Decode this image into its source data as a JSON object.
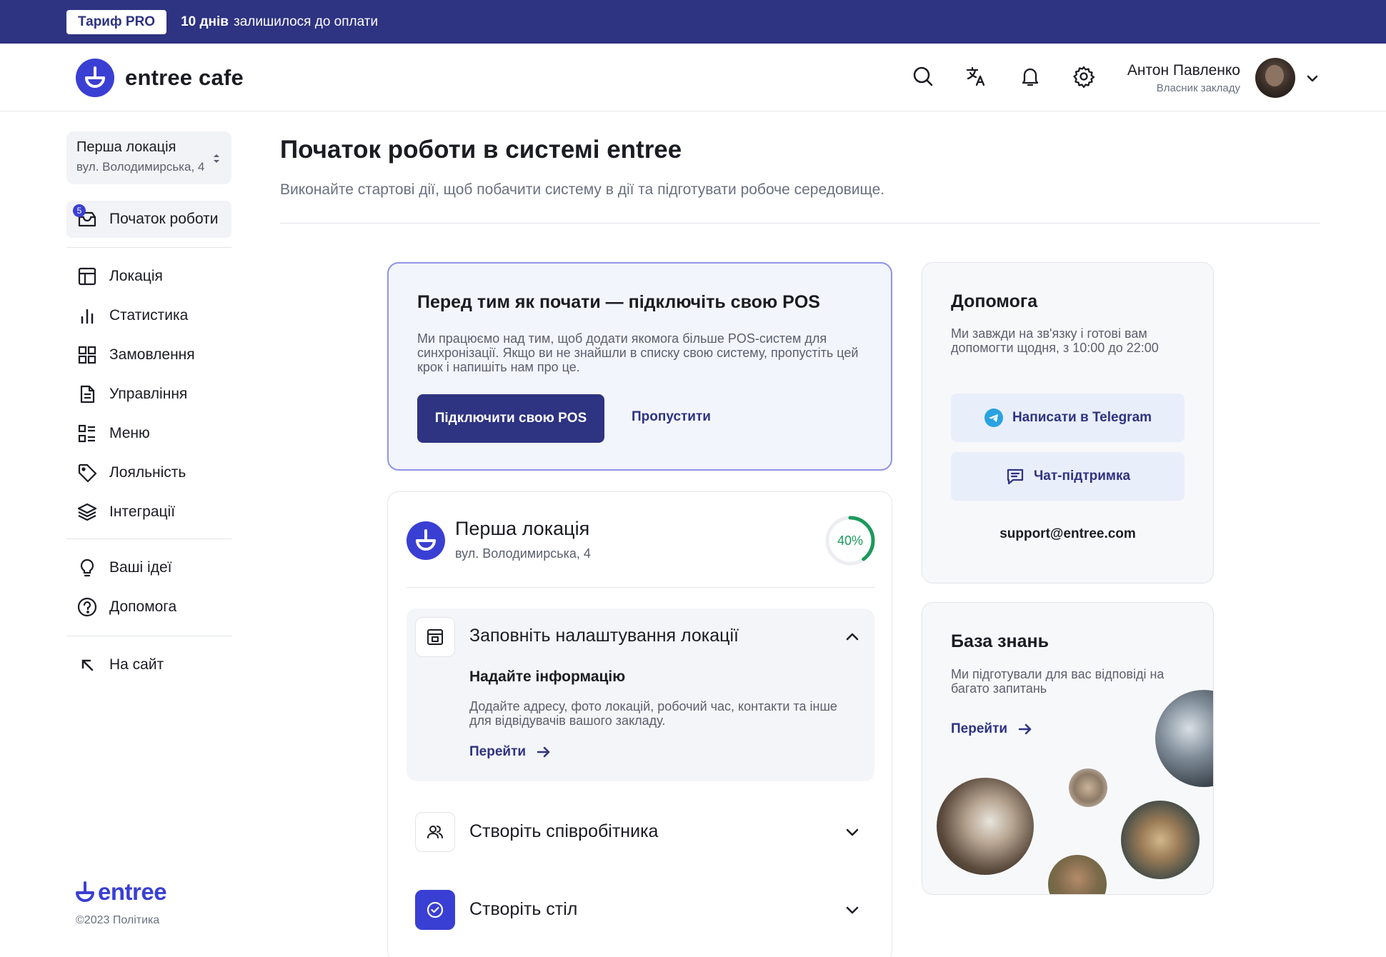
{
  "banner": {
    "plan": "Тариф PRO",
    "days": "10 днів",
    "rest": "залишилося до оплати"
  },
  "header": {
    "logo_text": "entree cafe",
    "user_name": "Антон Павленко",
    "user_role": "Власник закладу",
    "icons": [
      "search-icon",
      "translate-icon",
      "bell-icon",
      "gear-icon"
    ]
  },
  "sidebar": {
    "location": {
      "name": "Перша локація",
      "address": "вул. Володимирська, 4"
    },
    "start": {
      "label": "Початок роботи",
      "badge": "5"
    },
    "items": [
      {
        "label": "Локація",
        "icon": "layout-icon"
      },
      {
        "label": "Статистика",
        "icon": "bar-chart-icon"
      },
      {
        "label": "Замовлення",
        "icon": "grid-icon"
      },
      {
        "label": "Управління",
        "icon": "document-icon"
      },
      {
        "label": "Меню",
        "icon": "menu-list-icon"
      },
      {
        "label": "Лояльність",
        "icon": "tag-icon"
      },
      {
        "label": "Інтеграції",
        "icon": "layers-icon"
      }
    ],
    "secondary": [
      {
        "label": "Ваші ідеї",
        "icon": "lightbulb-icon"
      },
      {
        "label": "Допомога",
        "icon": "help-circle-icon"
      }
    ],
    "site": {
      "label": "На сайт",
      "icon": "arrow-up-left-icon"
    },
    "footer": {
      "logo": "entree",
      "copyright": "©2023",
      "policy": "Політика"
    }
  },
  "main": {
    "title": "Початок роботи в системі entree",
    "subtitle": "Виконайте стартові дії, щоб побачити систему в дії та підготувати робоче середовище."
  },
  "pos_card": {
    "title": "Перед тим як почати — підключіть свою POS",
    "text": "Ми працюємо над тим, щоб додати якомога більше POS-систем для синхронізації. Якщо ви не знайшли в списку свою систему, пропустіть цей крок і напишіть нам про це.",
    "primary": "Підключити свою POS",
    "skip": "Пропустити"
  },
  "location_card": {
    "name": "Перша локація",
    "address": "вул. Володимирська, 4",
    "progress_label": "40%",
    "progress": 0.4,
    "steps": [
      {
        "title": "Заповніть налаштування локації",
        "subtitle": "Надайте інформацію",
        "description": "Додайте адресу, фото локацій, робочий час, контакти та інше для відвідувачів вашого закладу.",
        "link": "Перейти",
        "expanded": true
      },
      {
        "title": "Створіть співробітника",
        "expanded": false
      },
      {
        "title": "Створіть стіл",
        "expanded": false,
        "done": true
      }
    ]
  },
  "help_card": {
    "title": "Допомога",
    "text": "Ми завжди на зв'язку і готові вам допомогти щодня, з 10:00 до 22:00",
    "telegram": "Написати в Telegram",
    "chat": "Чат-підтримка",
    "email": "support@entree.com"
  },
  "kb_card": {
    "title": "База знань",
    "text": "Ми підготували для вас відповіді на багато запитань",
    "link": "Перейти"
  },
  "colors": {
    "brand": "#3a3fd3",
    "navy": "#2e3382",
    "success": "#1b9a5b"
  }
}
